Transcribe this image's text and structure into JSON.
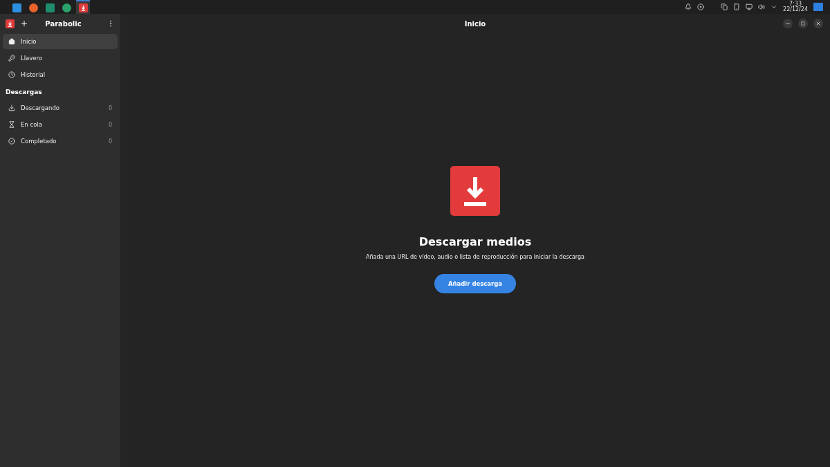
{
  "taskbar": {
    "apps": [
      {
        "kind": "code",
        "selected": false
      },
      {
        "kind": "browser",
        "selected": false
      },
      {
        "kind": "shield",
        "selected": false
      },
      {
        "kind": "edge",
        "selected": false
      },
      {
        "kind": "download",
        "selected": true
      }
    ],
    "clock": {
      "time": "7:33",
      "date": "22/12/24"
    }
  },
  "sidebar": {
    "title": "Parabolic",
    "items": [
      {
        "label": "Inicio",
        "kind": "home",
        "selected": true
      },
      {
        "label": "Llavero",
        "kind": "key",
        "selected": false
      },
      {
        "label": "Historial",
        "kind": "clock",
        "selected": false
      }
    ],
    "section": "Descargas",
    "downloads": [
      {
        "label": "Descargando",
        "kind": "download",
        "count": "0",
        "selected": false
      },
      {
        "label": "En cola",
        "kind": "hourglass",
        "count": "0",
        "selected": false
      },
      {
        "label": "Completado",
        "kind": "check",
        "count": "0",
        "selected": false
      }
    ]
  },
  "main": {
    "title": "Inicio",
    "heading": "Descargar medios",
    "description": "Añada una URL de vídeo, audio o lista de reproducción para iniciar la descarga",
    "button": "Añadir descarga"
  }
}
